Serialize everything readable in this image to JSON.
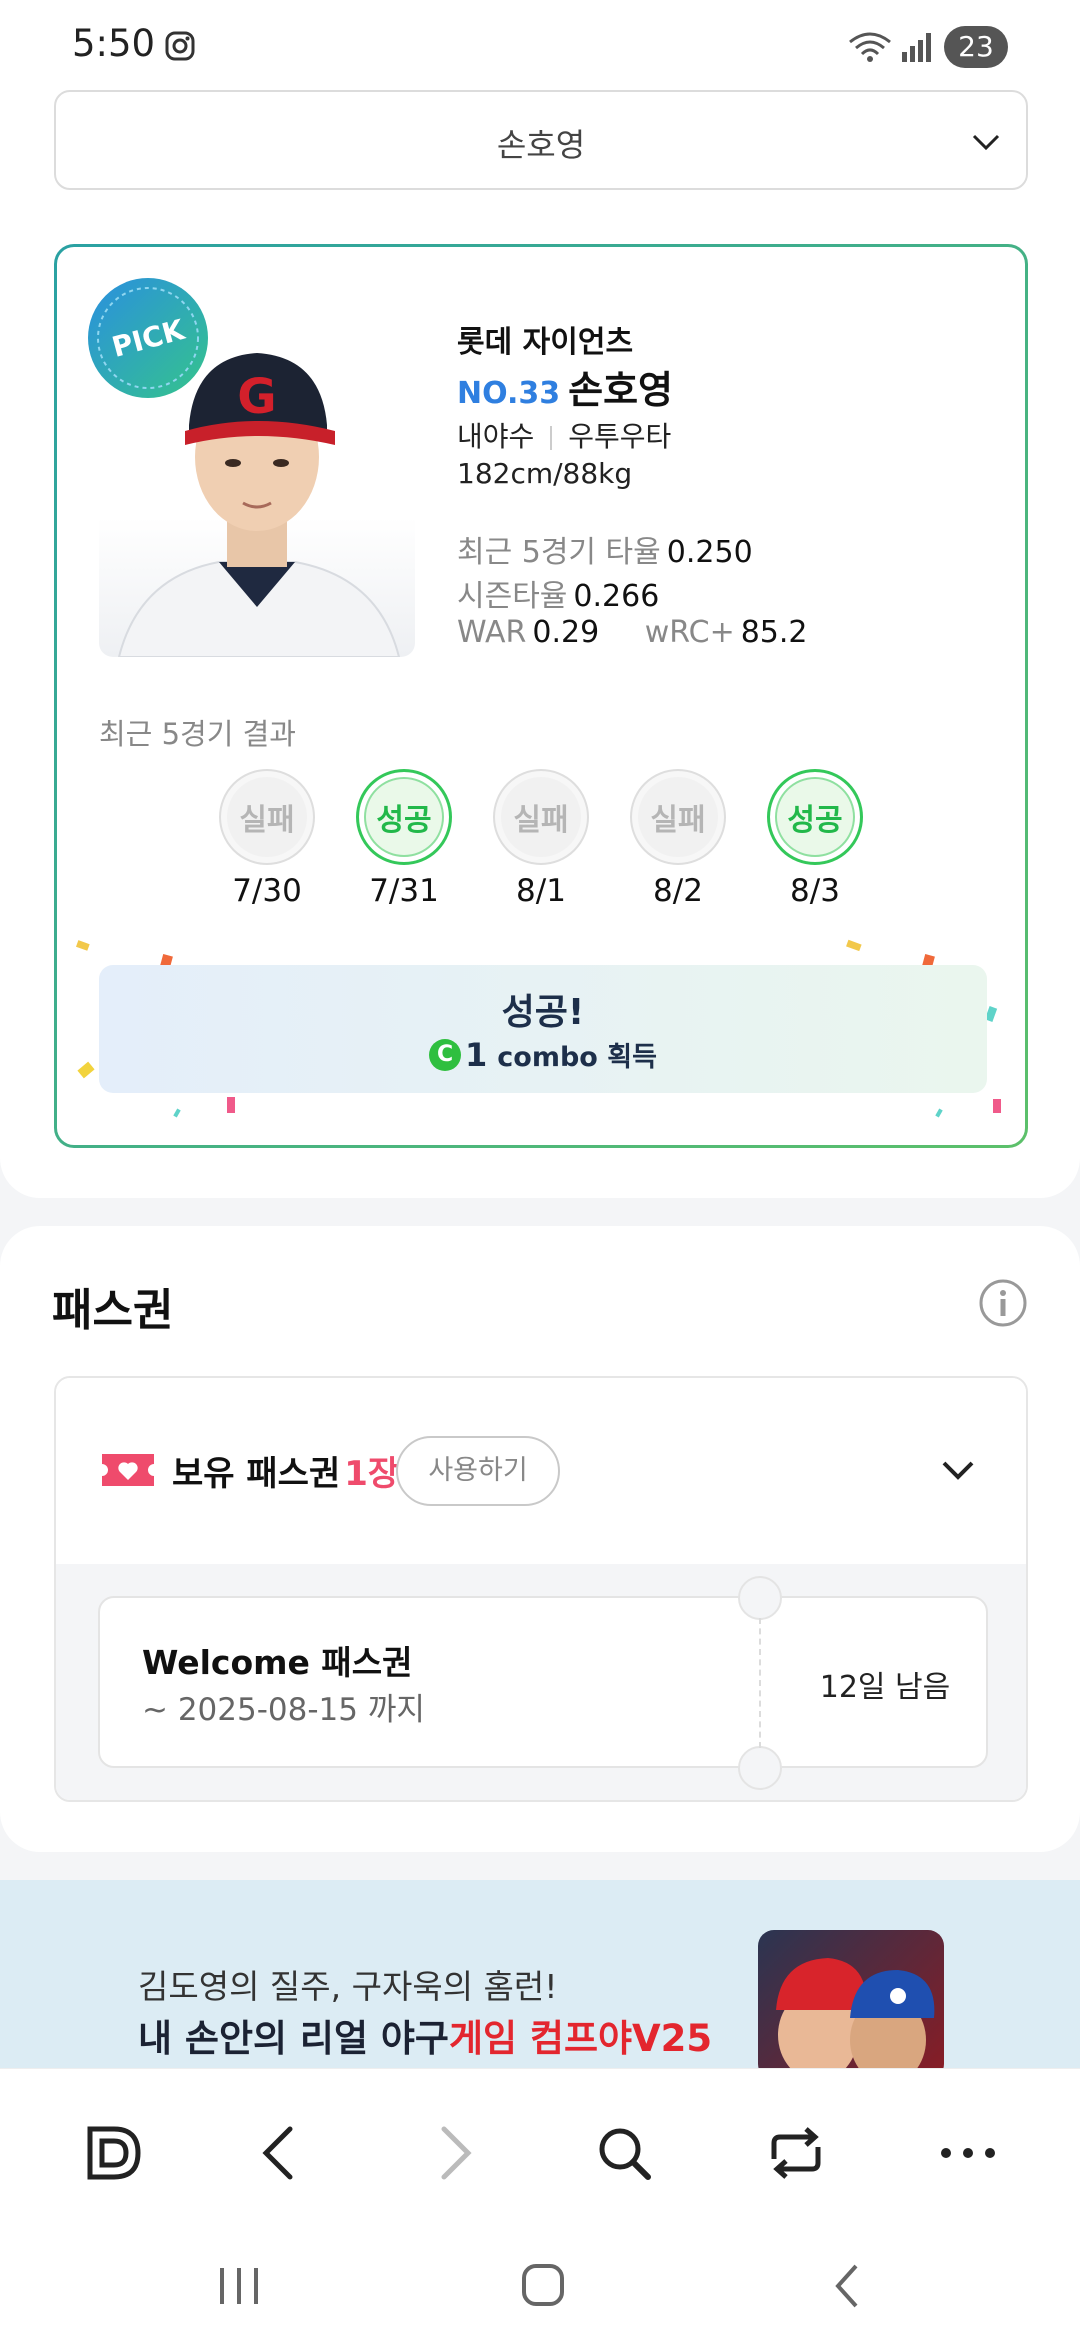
{
  "status_bar": {
    "time": "5:50",
    "battery": "23"
  },
  "player_select": {
    "value": "손호영"
  },
  "player": {
    "badge": "PICK",
    "team": "롯데 자이언츠",
    "number": "NO.33",
    "name": "손호영",
    "position": "내야수",
    "hand": "우투우타",
    "body": "182cm/88kg",
    "recent_avg_label": "최근 5경기 타율",
    "recent_avg": "0.250",
    "season_avg_label": "시즌타율",
    "season_avg": "0.266",
    "war_label": "WAR",
    "war": "0.29",
    "wrc_label": "wRC+",
    "wrc": "85.2"
  },
  "recent_games": {
    "title": "최근 5경기 결과",
    "games": [
      {
        "result": "실패",
        "date": "7/30",
        "status": "fail"
      },
      {
        "result": "성공",
        "date": "7/31",
        "status": "success"
      },
      {
        "result": "실패",
        "date": "8/1",
        "status": "fail"
      },
      {
        "result": "실패",
        "date": "8/2",
        "status": "fail"
      },
      {
        "result": "성공",
        "date": "8/3",
        "status": "success"
      }
    ]
  },
  "result_banner": {
    "title": "성공!",
    "combo_icon": "C",
    "combo_count": "1",
    "combo_text": "combo 획득"
  },
  "pass": {
    "title": "패스권",
    "owned_label": "보유 패스권",
    "owned_count": "1장",
    "use_button": "사용하기",
    "tickets": [
      {
        "name": "Welcome 패스권",
        "expiry": "~ 2025-08-15 까지",
        "remaining": "12일 남음"
      }
    ]
  },
  "ad": {
    "line1": "김도영의 질주, 구자욱의 홈런!",
    "line2_prefix": "내 손안의 리얼 야구",
    "line2_highlight": "게임 컴프야V25"
  },
  "colors": {
    "accent_blue": "#2f7fe0",
    "success_green": "#22b84a",
    "pink": "#ef4b6c",
    "ad_red": "#e3262e"
  },
  "toolbar": {
    "icons": [
      "d-logo-icon",
      "back-icon",
      "forward-icon",
      "search-icon",
      "share-icon",
      "more-icon"
    ]
  },
  "navbar": {
    "icons": [
      "recent-apps-icon",
      "home-icon",
      "back-nav-icon"
    ]
  }
}
